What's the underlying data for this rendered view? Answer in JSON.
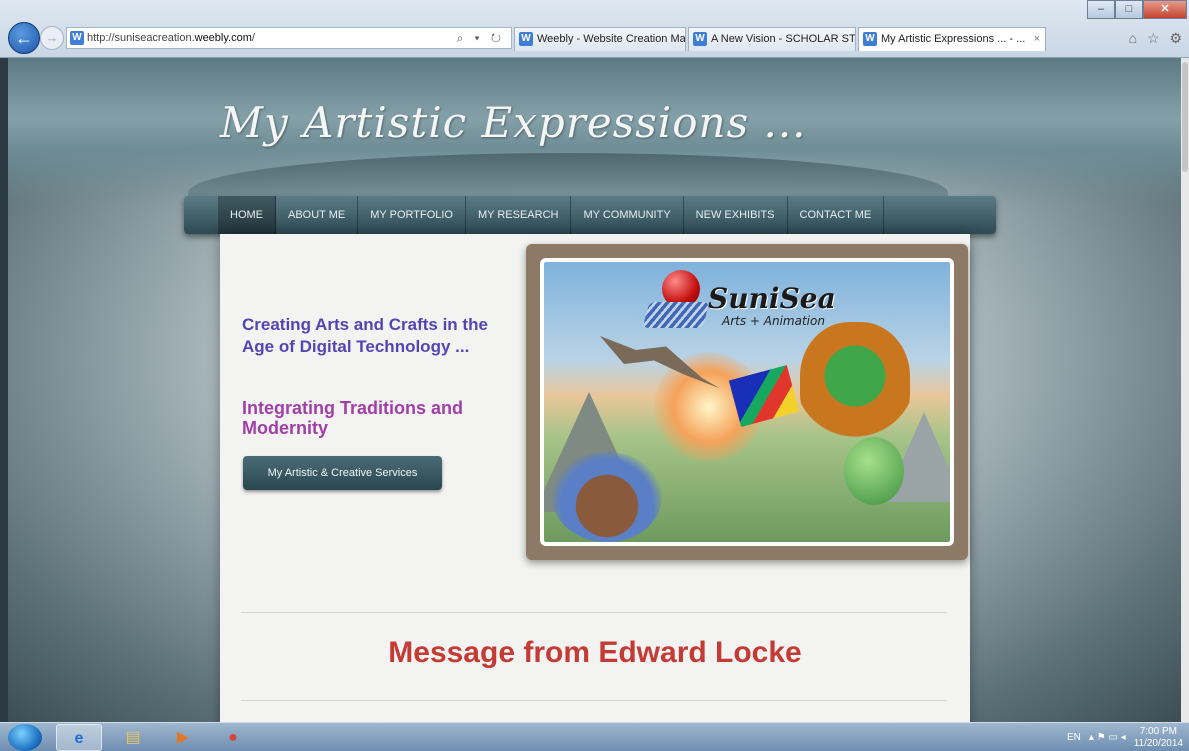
{
  "browser": {
    "address_prefix": "http://suniseacreation.",
    "address_host": "weebly.com",
    "address_suffix": "/",
    "address_tools": "⌕ ▾ ↻",
    "tabs": [
      {
        "label": "Weebly - Website Creation Ma..."
      },
      {
        "label": "A New Vision - SCHOLAR STE..."
      },
      {
        "label": "My Artistic Expressions ... - ..."
      }
    ],
    "tab_close": "×",
    "back_glyph": "←",
    "forward_glyph": "→",
    "window_controls": {
      "minimize": "–",
      "maximize": "□",
      "close": "✕"
    },
    "toolbar_icons": "⌂ ☆ ⚙"
  },
  "site": {
    "title": "My Artistic Expressions ...",
    "nav": [
      "HOME",
      "ABOUT ME",
      "MY PORTFOLIO",
      "MY RESEARCH",
      "MY COMMUNITY",
      "NEW EXHIBITS",
      "CONTACT ME"
    ],
    "headline": "Creating Arts and Crafts in the Age of Digital Technology ...",
    "subline": "Integrating Traditions and Modernity",
    "cta_label": "My Artistic & Creative Services",
    "logo_text": "SuniSea",
    "logo_sub": "Arts + Animation",
    "message_heading": "Message from Edward Locke"
  },
  "taskbar": {
    "language": "EN",
    "tray_icons": "▴ ⚑ ▭ ◂",
    "time": "7:00 PM",
    "date": "11/20/2014"
  },
  "colors": {
    "headline": "#5346b3",
    "subline": "#a13ea8",
    "message": "#c43a34",
    "nav": "#3c5a63"
  }
}
